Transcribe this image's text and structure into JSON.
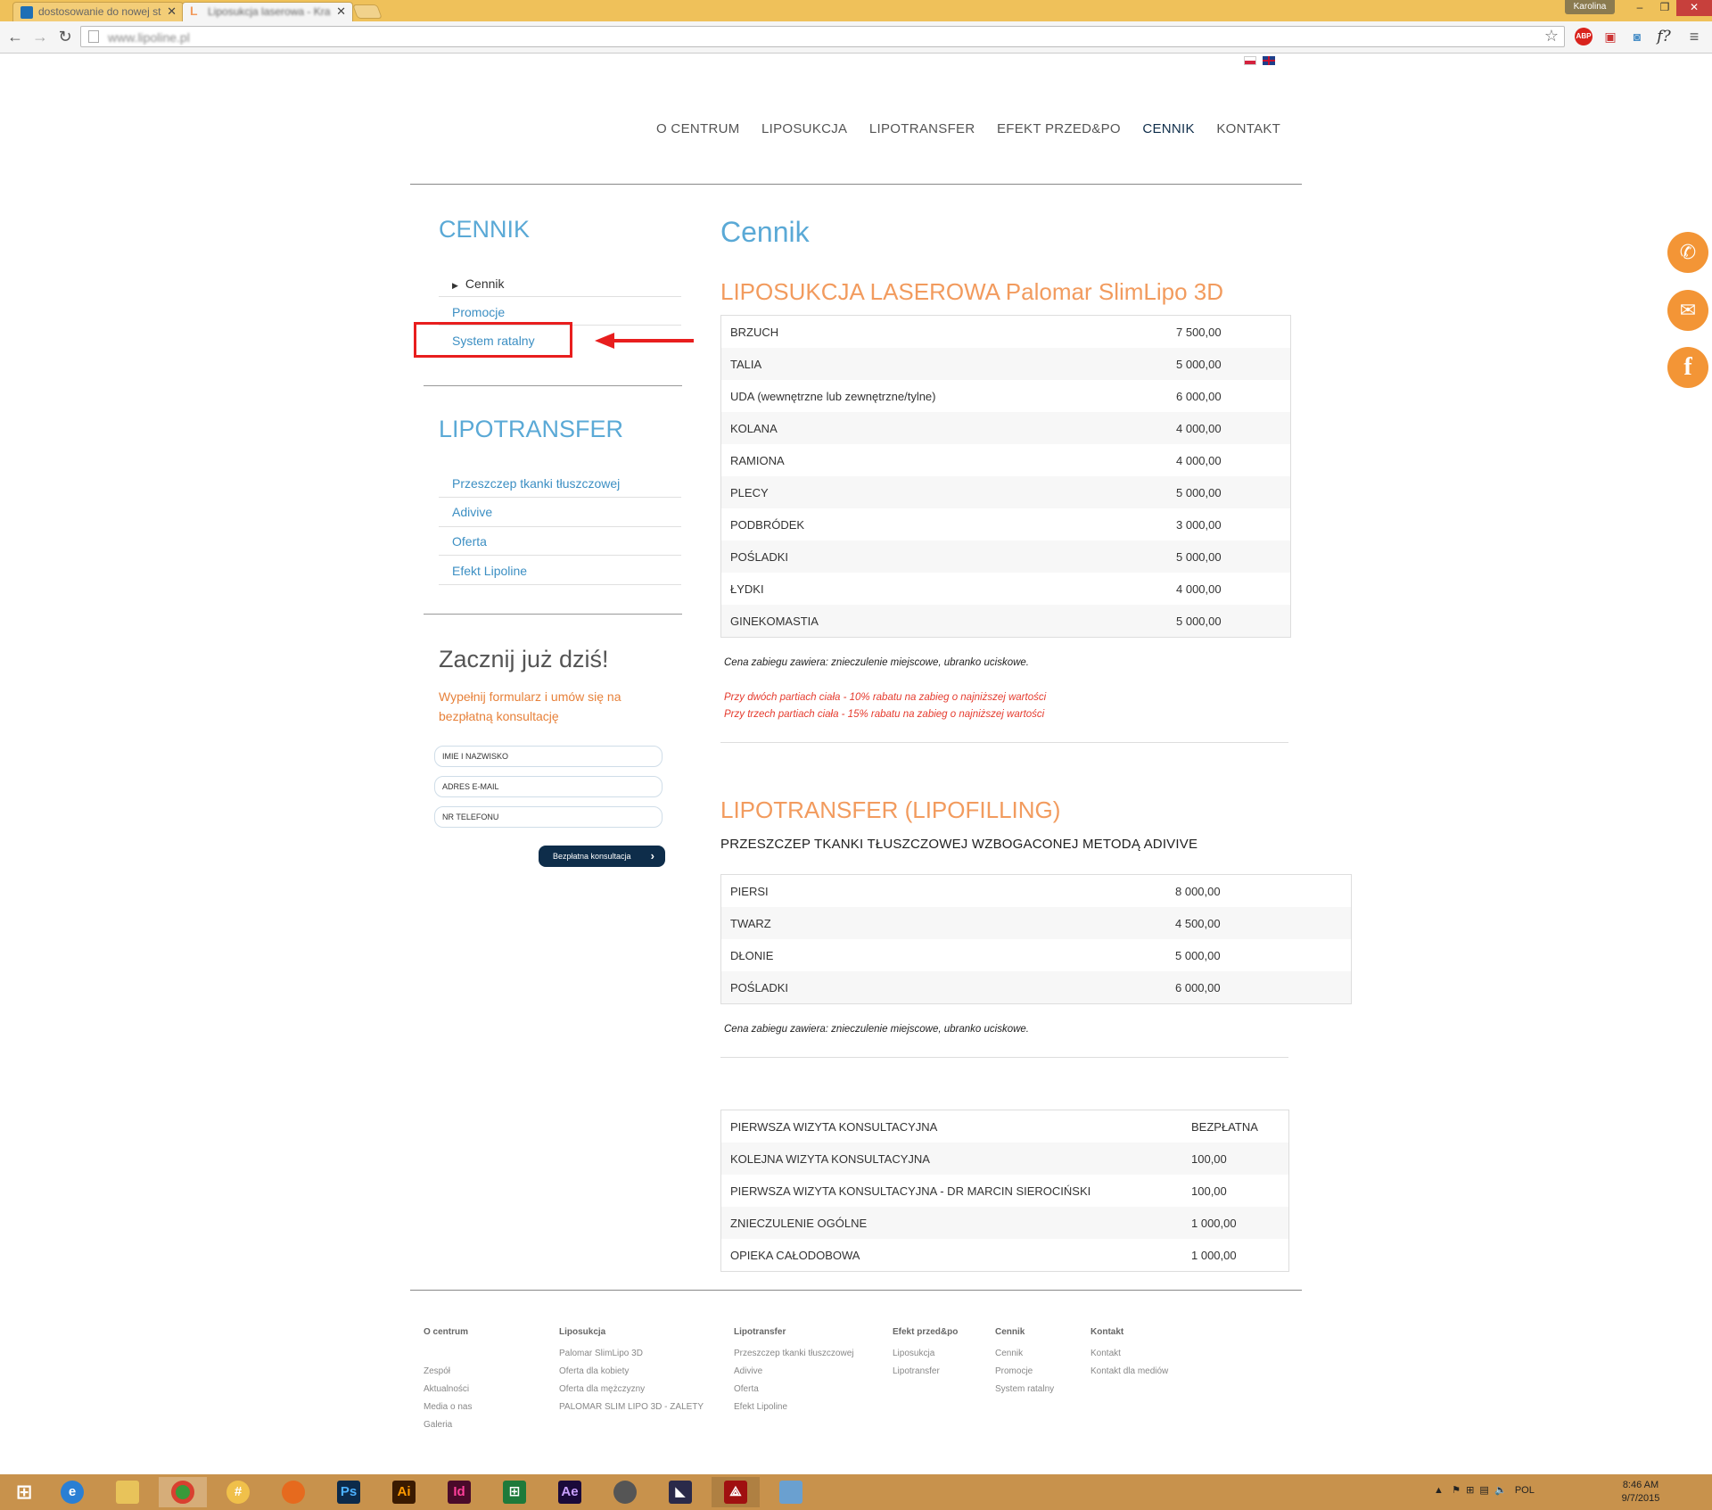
{
  "browser": {
    "tabs": [
      {
        "title": "dostosowanie do nowej st"
      },
      {
        "title": "Liposukcja laserowa - Kra"
      }
    ],
    "profile": "Karolina",
    "url": "www.lipoline.pl"
  },
  "nav": {
    "items": [
      "O CENTRUM",
      "LIPOSUKCJA",
      "LIPOTRANSFER",
      "EFEKT PRZED&PO",
      "CENNIK",
      "KONTAKT"
    ],
    "active": "CENNIK"
  },
  "sidebar": {
    "cennik_heading": "CENNIK",
    "cennik_items": [
      "Cennik",
      "Promocje",
      "System ratalny"
    ],
    "lipo_heading": "LIPOTRANSFER",
    "lipo_items": [
      "Przeszczep tkanki tłuszczowej",
      "Adivive",
      "Oferta",
      "Efekt Lipoline"
    ],
    "cta_heading": "Zacznij już dziś!",
    "cta_text": "Wypełnij formularz i umów się na bezpłatną konsultację",
    "fields": [
      "IMIE I NAZWISKO",
      "ADRES E-MAIL",
      "NR TELEFONU"
    ],
    "button": "Bezpłatna konsultacja"
  },
  "main": {
    "title": "Cennik",
    "section1": {
      "title": "LIPOSUKCJA LASEROWA Palomar SlimLipo 3D",
      "rows": [
        {
          "name": "BRZUCH",
          "price": "7 500,00"
        },
        {
          "name": "TALIA",
          "price": "5 000,00"
        },
        {
          "name": "UDA (wewnętrzne lub zewnętrzne/tylne)",
          "price": "6 000,00"
        },
        {
          "name": "KOLANA",
          "price": "4 000,00"
        },
        {
          "name": "RAMIONA",
          "price": "4 000,00"
        },
        {
          "name": "PLECY",
          "price": "5 000,00"
        },
        {
          "name": "PODBRÓDEK",
          "price": "3 000,00"
        },
        {
          "name": "POŚLADKI",
          "price": "5 000,00"
        },
        {
          "name": "ŁYDKI",
          "price": "4 000,00"
        },
        {
          "name": "GINEKOMASTIA",
          "price": "5 000,00"
        }
      ],
      "note": "Cena zabiegu zawiera: znieczulenie miejscowe, ubranko uciskowe.",
      "promo1": "Przy dwóch partiach ciała - 10% rabatu na zabieg o najniższej wartości",
      "promo2": "Przy trzech partiach ciała - 15% rabatu na zabieg o najniższej wartości"
    },
    "section2": {
      "title": "LIPOTRANSFER (LIPOFILLING)",
      "subtitle": "PRZESZCZEP TKANKI TŁUSZCZOWEJ WZBOGACONEJ METODĄ ADIVIVE",
      "rows": [
        {
          "name": "PIERSI",
          "price": "8 000,00"
        },
        {
          "name": "TWARZ",
          "price": "4 500,00"
        },
        {
          "name": "DŁONIE",
          "price": "5 000,00"
        },
        {
          "name": "POŚLADKI",
          "price": "6 000,00"
        }
      ],
      "note": "Cena zabiegu zawiera: znieczulenie miejscowe, ubranko uciskowe."
    },
    "section3": {
      "rows": [
        {
          "name": "PIERWSZA WIZYTA KONSULTACYJNA",
          "price": "BEZPŁATNA"
        },
        {
          "name": "KOLEJNA WIZYTA KONSULTACYJNA",
          "price": "100,00"
        },
        {
          "name": "PIERWSZA WIZYTA KONSULTACYJNA - DR MARCIN SIEROCIŃSKI",
          "price": "100,00"
        },
        {
          "name": "ZNIECZULENIE OGÓLNE",
          "price": "1 000,00"
        },
        {
          "name": "OPIEKA CAŁODOBOWA",
          "price": "1 000,00"
        }
      ]
    }
  },
  "footer": [
    {
      "heading": "O centrum",
      "links": [
        "",
        "Zespół",
        "Aktualności",
        "Media o nas",
        "Galeria"
      ]
    },
    {
      "heading": "Liposukcja",
      "links": [
        "Palomar SlimLipo 3D",
        "Oferta dla kobiety",
        "Oferta dla mężczyzny",
        "PALOMAR SLIM LIPO 3D - ZALETY"
      ]
    },
    {
      "heading": "Lipotransfer",
      "links": [
        "Przeszczep tkanki tłuszczowej",
        "Adivive",
        "Oferta",
        "Efekt Lipoline"
      ]
    },
    {
      "heading": "Efekt przed&po",
      "links": [
        "Liposukcja",
        "Lipotransfer"
      ]
    },
    {
      "heading": "Cennik",
      "links": [
        "Cennik",
        "Promocje",
        "System ratalny"
      ]
    },
    {
      "heading": "Kontakt",
      "links": [
        "Kontakt",
        "Kontakt dla mediów"
      ]
    }
  ],
  "taskbar": {
    "apps": [
      "windows-start",
      "internet-explorer",
      "file-explorer",
      "chrome",
      "slack",
      "firefox",
      "Ps",
      "Ai",
      "Id",
      "excel",
      "Ae",
      "evernote",
      "premiere",
      "acrobat",
      "photos"
    ],
    "lang": "POL",
    "time": "8:46 AM",
    "date": "9/7/2015"
  },
  "colors": {
    "accent_blue": "#5aa9d6",
    "accent_orange": "#f29b5e",
    "social_orange": "#f39536",
    "annotation_red": "#e81e1e"
  }
}
